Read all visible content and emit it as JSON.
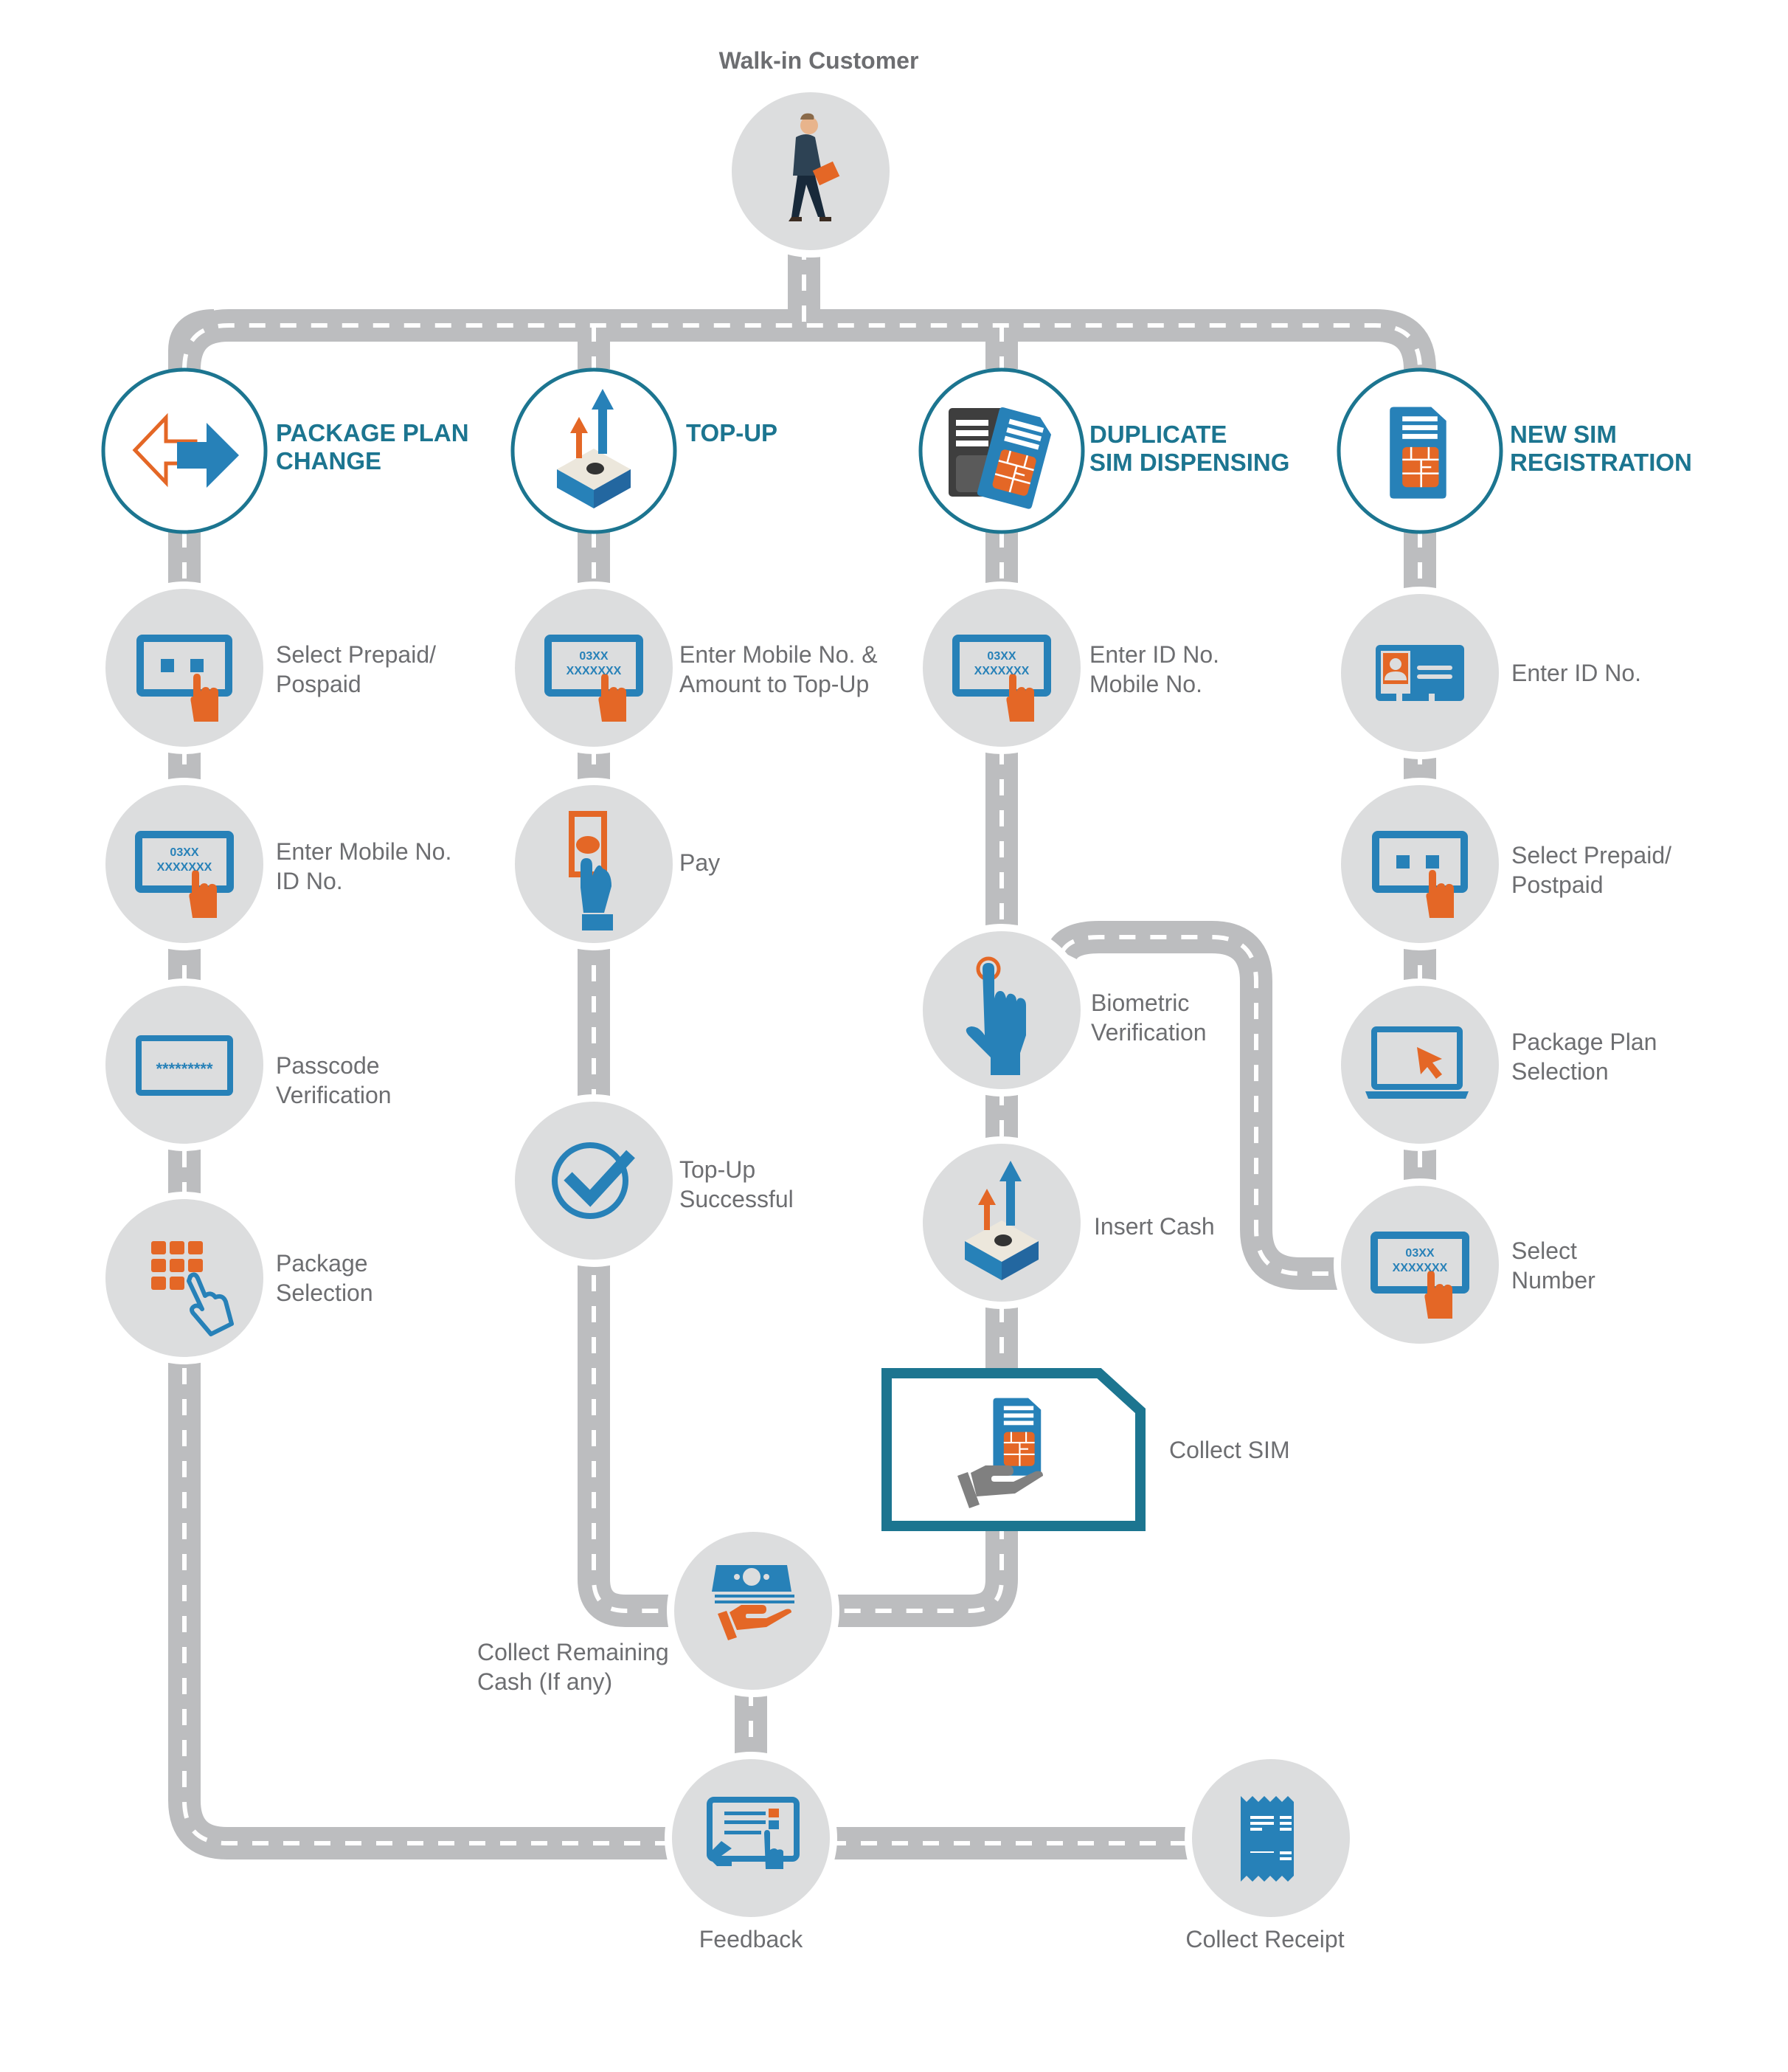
{
  "title": "Walk-in Customer",
  "colors": {
    "teal": "#1c7590",
    "blue": "#2781b8",
    "orange": "#e46726",
    "road": "#bcbdbf",
    "circle": "#dcddde",
    "text": "#6d6e71"
  },
  "start": {
    "label": "Walk-in Customer",
    "icon": "walking-businessman-icon"
  },
  "branches": [
    {
      "id": "package-plan-change",
      "title_lines": [
        "PACKAGE PLAN",
        "CHANGE"
      ],
      "icon": "swap-arrows-icon",
      "steps": [
        {
          "lines": [
            "Select Prepaid/",
            "Pospaid"
          ],
          "icon": "touch-screen-select-icon"
        },
        {
          "lines": [
            "Enter Mobile No.",
            "ID No."
          ],
          "icon": "touch-screen-number-icon",
          "screen_text": [
            "03XX",
            "XXXXXXX"
          ]
        },
        {
          "lines": [
            "Passcode",
            "Verification"
          ],
          "icon": "passcode-screen-icon",
          "screen_text": [
            "*********"
          ]
        },
        {
          "lines": [
            "Package",
            "Selection"
          ],
          "icon": "keypad-touch-icon"
        }
      ]
    },
    {
      "id": "top-up",
      "title_lines": [
        "TOP-UP"
      ],
      "icon": "cash-topup-icon",
      "steps": [
        {
          "lines": [
            "Enter Mobile No. &",
            "Amount to Top-Up"
          ],
          "icon": "touch-screen-number-icon",
          "screen_text": [
            "03XX",
            "XXXXXXX"
          ]
        },
        {
          "lines": [
            "Pay"
          ],
          "icon": "hand-banknote-icon"
        },
        {
          "lines": [
            "Top-Up",
            "Successful"
          ],
          "icon": "check-circle-icon"
        }
      ]
    },
    {
      "id": "duplicate-sim-dispensing",
      "title_lines": [
        "DUPLICATE",
        "SIM DISPENSING"
      ],
      "icon": "duplicate-sim-icon",
      "steps": [
        {
          "lines": [
            "Enter ID No.",
            "Mobile No."
          ],
          "icon": "touch-screen-number-icon",
          "screen_text": [
            "03XX",
            "XXXXXXX"
          ]
        },
        {
          "lines": [
            "Biometric",
            "Verification"
          ],
          "icon": "fingerprint-touch-icon"
        },
        {
          "lines": [
            "Insert Cash"
          ],
          "icon": "cash-topup-icon"
        },
        {
          "lines": [
            "Collect SIM"
          ],
          "icon": "hand-sim-icon"
        }
      ]
    },
    {
      "id": "new-sim-registration",
      "title_lines": [
        "NEW SIM",
        "REGISTRATION"
      ],
      "icon": "sim-card-icon",
      "steps": [
        {
          "lines": [
            "Enter ID No."
          ],
          "icon": "id-card-icon"
        },
        {
          "lines": [
            "Select Prepaid/",
            "Postpaid"
          ],
          "icon": "touch-screen-select-icon"
        },
        {
          "lines": [
            "Package Plan",
            "Selection"
          ],
          "icon": "laptop-cursor-icon"
        },
        {
          "lines": [
            "Select",
            "Number"
          ],
          "icon": "touch-screen-number-icon",
          "screen_text": [
            "03XX",
            "XXXXXXX"
          ]
        }
      ]
    }
  ],
  "finish": {
    "collect_cash": {
      "lines": [
        "Collect Remaining",
        "Cash (If any)"
      ],
      "icon": "hand-cash-icon"
    },
    "feedback": {
      "label": "Feedback",
      "icon": "tablet-feedback-icon"
    },
    "collect_receipt": {
      "label": "Collect Receipt",
      "icon": "receipt-icon"
    }
  }
}
